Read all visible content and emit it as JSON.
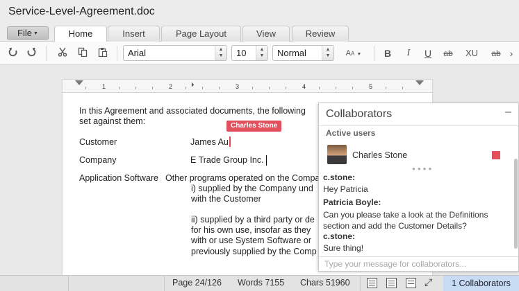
{
  "window": {
    "title": "Service-Level-Agreement.doc"
  },
  "tabs": [
    {
      "label": "File"
    },
    {
      "label": "Home"
    },
    {
      "label": "Insert"
    },
    {
      "label": "Page Layout"
    },
    {
      "label": "View"
    },
    {
      "label": "Review"
    }
  ],
  "toolbar": {
    "undo_icon": "undo-icon",
    "redo_icon": "redo-icon",
    "font_family": "Arial",
    "font_size": "10",
    "paragraph_style": "Normal",
    "bold": "B",
    "italic": "I",
    "underline": "U",
    "strikethrough": "ab",
    "subscript": "XU",
    "clear_format": "ab"
  },
  "ruler": {
    "numbers": [
      "1",
      "2",
      "3",
      "4",
      "5"
    ]
  },
  "document": {
    "intro_line1": "In this Agreement and associated documents, the following",
    "intro_line2": "set against them:",
    "rows": [
      {
        "label": "Customer",
        "value": "James Au"
      },
      {
        "label": "Company",
        "value": "E Trade Group Inc."
      }
    ],
    "app_software_label": "Application Software",
    "app_lines": [
      "Other programs operated on the Compa",
      "i) supplied by the Company und",
      "with the Customer",
      "ii) supplied by a third party or de",
      "for his own use, insofar as they",
      "with or use System Software or",
      "previously supplied by the Comp"
    ],
    "remote_cursor_name": "Charles Stone"
  },
  "collaborators": {
    "title": "Collaborators",
    "minimize": "–",
    "active_label": "Active users",
    "users": [
      {
        "name": "Charles Stone",
        "color": "#e2505e"
      }
    ],
    "messages": [
      {
        "author": "c.stone:",
        "lines": [
          "Hey Patricia"
        ]
      },
      {
        "author": "Patricia Boyle:",
        "lines": [
          "Can you please take a look at the Definitions",
          "section and add the Customer Details?"
        ]
      },
      {
        "author": "c.stone:",
        "lines": [
          "Sure thing!"
        ]
      }
    ],
    "input_placeholder": "Type your message for collaborators..."
  },
  "status": {
    "page": "Page 24/126",
    "words": "Words 7155",
    "chars": "Chars 51960",
    "collaborators_button": "1 Collaborators"
  }
}
